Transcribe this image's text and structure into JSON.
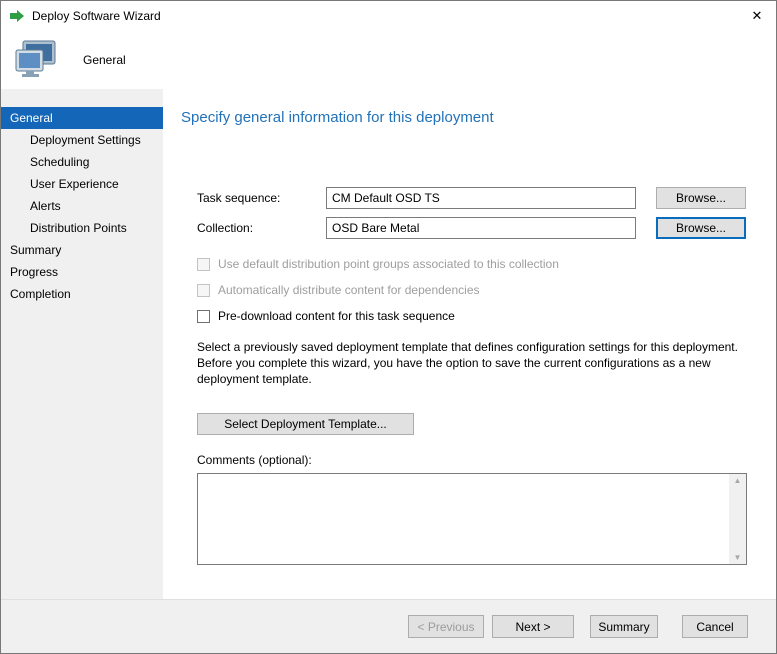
{
  "window": {
    "title": "Deploy Software Wizard"
  },
  "icons": {
    "deploy": "green-arrow",
    "general_page": "computer-monitors",
    "close": "✕",
    "scroll_up": "▲",
    "scroll_down": "▼"
  },
  "header": {
    "page_label": "General"
  },
  "sidebar": {
    "items": [
      {
        "label": "General",
        "selected": true
      },
      {
        "label": "Deployment Settings",
        "indent": true
      },
      {
        "label": "Scheduling",
        "indent": true
      },
      {
        "label": "User Experience",
        "indent": true
      },
      {
        "label": "Alerts",
        "indent": true
      },
      {
        "label": "Distribution Points",
        "indent": true
      },
      {
        "label": "Summary"
      },
      {
        "label": "Progress"
      },
      {
        "label": "Completion"
      }
    ]
  },
  "main": {
    "heading": "Specify general information for this deployment",
    "fields": {
      "task_sequence": {
        "label": "Task sequence:",
        "value": "CM Default OSD TS",
        "browse_label": "Browse..."
      },
      "collection": {
        "label": "Collection:",
        "value": "OSD Bare Metal",
        "browse_label": "Browse..."
      }
    },
    "checkboxes": [
      {
        "label": "Use default distribution point groups associated to this collection",
        "disabled": true,
        "checked": false
      },
      {
        "label": "Automatically distribute content for dependencies",
        "disabled": true,
        "checked": false
      },
      {
        "label": "Pre-download content for this task sequence",
        "disabled": false,
        "checked": false
      }
    ],
    "template_note": "Select a previously saved deployment template that defines configuration settings for this deployment. Before you complete this wizard, you have the option to save the current configurations as a new deployment template.",
    "select_template_button": "Select Deployment Template...",
    "comments": {
      "label": "Comments (optional):",
      "value": ""
    }
  },
  "footer": {
    "previous_label": "< Previous",
    "next_label": "Next >",
    "summary_label": "Summary",
    "cancel_label": "Cancel"
  },
  "colors": {
    "accent": "#1467b8",
    "heading": "#2272b9",
    "focus": "#0a6cbd"
  }
}
